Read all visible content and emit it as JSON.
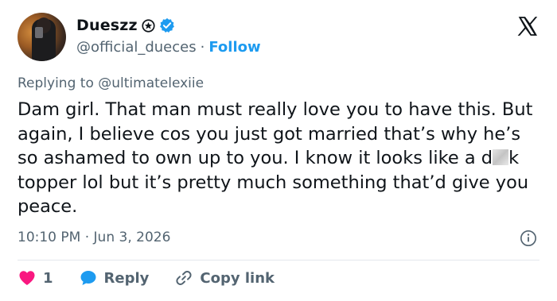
{
  "author": {
    "name": "Dueszz",
    "handle": "@official_dueces",
    "separator": "·",
    "follow_label": "Follow"
  },
  "reply": {
    "prefix": "Replying to",
    "mention": "@ultimatelexiie"
  },
  "tweet": {
    "text_before": "Dam girl. That man must really love you to have this. But again, I believe cos you just got married that’s why he’s so ashamed to own up to you. I know it looks like a d",
    "text_after": "k topper lol but it’s pretty much something that’d give you peace."
  },
  "meta": {
    "time": "10:10 PM",
    "separator": "·",
    "date": "Jun 3, 2026"
  },
  "actions": {
    "like_count": "1",
    "reply_label": "Reply",
    "copy_label": "Copy link"
  },
  "colors": {
    "accent": "#1d9bf0",
    "like": "#f91880",
    "muted": "#536471"
  },
  "icons": [
    "org-badge-icon",
    "verified-badge-icon",
    "x-logo-icon",
    "info-icon",
    "heart-icon",
    "reply-bubble-icon",
    "link-icon"
  ]
}
